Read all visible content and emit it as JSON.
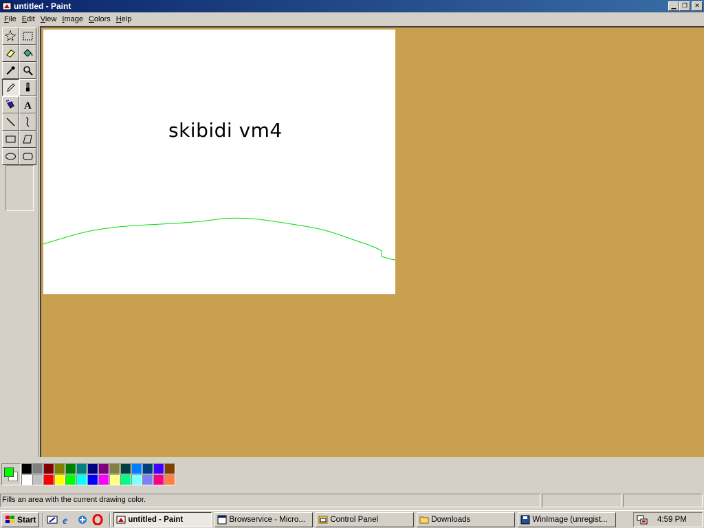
{
  "window": {
    "title": "untitled - Paint",
    "app_icon": "paint-icon"
  },
  "window_buttons": {
    "minimize": "0",
    "restore": "1",
    "close": "r"
  },
  "menu": [
    {
      "label": "File",
      "accel": "F",
      "rest": "ile"
    },
    {
      "label": "Edit",
      "accel": "E",
      "rest": "dit"
    },
    {
      "label": "View",
      "accel": "V",
      "rest": "iew"
    },
    {
      "label": "Image",
      "accel": "I",
      "rest": "mage"
    },
    {
      "label": "Colors",
      "accel": "C",
      "rest": "olors"
    },
    {
      "label": "Help",
      "accel": "H",
      "rest": "elp"
    }
  ],
  "tools": [
    {
      "name": "free-form-select-tool",
      "icon": "star-select-icon"
    },
    {
      "name": "select-tool",
      "icon": "rect-select-icon"
    },
    {
      "name": "eraser-tool",
      "icon": "eraser-icon"
    },
    {
      "name": "fill-tool",
      "icon": "paint-bucket-icon"
    },
    {
      "name": "pick-color-tool",
      "icon": "eyedropper-icon"
    },
    {
      "name": "magnifier-tool",
      "icon": "magnifier-icon"
    },
    {
      "name": "pencil-tool",
      "icon": "pencil-icon",
      "active": true
    },
    {
      "name": "brush-tool",
      "icon": "brush-icon"
    },
    {
      "name": "airbrush-tool",
      "icon": "airbrush-icon"
    },
    {
      "name": "text-tool",
      "icon": "text-icon"
    },
    {
      "name": "line-tool",
      "icon": "line-icon"
    },
    {
      "name": "curve-tool",
      "icon": "curve-icon"
    },
    {
      "name": "rectangle-tool",
      "icon": "rectangle-icon"
    },
    {
      "name": "polygon-tool",
      "icon": "polygon-icon"
    },
    {
      "name": "ellipse-tool",
      "icon": "ellipse-icon"
    },
    {
      "name": "rounded-rectangle-tool",
      "icon": "rounded-rectangle-icon"
    }
  ],
  "canvas": {
    "text": "skibidi vm4",
    "stroke_color": "#00dd00"
  },
  "colors": {
    "foreground": "#00ff00",
    "background": "#ffffff",
    "workspace": "#c9a04f",
    "palette_top": [
      "#000000",
      "#808080",
      "#800000",
      "#808000",
      "#008000",
      "#008080",
      "#000080",
      "#800080",
      "#808040",
      "#004040",
      "#0080ff",
      "#004080",
      "#4000ff",
      "#804000"
    ],
    "palette_bottom": [
      "#ffffff",
      "#c0c0c0",
      "#ff0000",
      "#ffff00",
      "#00ff00",
      "#00ffff",
      "#0000ff",
      "#ff00ff",
      "#ffff80",
      "#00ff80",
      "#80ffff",
      "#8080ff",
      "#ff0080",
      "#ff8040"
    ]
  },
  "status": {
    "message": "Fills an area with the current drawing color.",
    "pane2": "",
    "pane3": ""
  },
  "taskbar": {
    "start_label": "Start",
    "quick_launch": [
      "show-desktop-icon",
      "internet-explorer-icon",
      "outlook-express-icon",
      "opera-icon"
    ],
    "tasks": [
      {
        "label": "untitled - Paint",
        "icon": "paint-icon",
        "active": true
      },
      {
        "label": "Browservice - Micro...",
        "icon": "ie-window-icon"
      },
      {
        "label": "Control Panel",
        "icon": "control-panel-icon"
      },
      {
        "label": "Downloads",
        "icon": "folder-icon"
      },
      {
        "label": "WinImage (unregist...",
        "icon": "floppy-icon"
      }
    ],
    "clock": "4:59 PM",
    "tray_icon": "network-tray-icon"
  }
}
